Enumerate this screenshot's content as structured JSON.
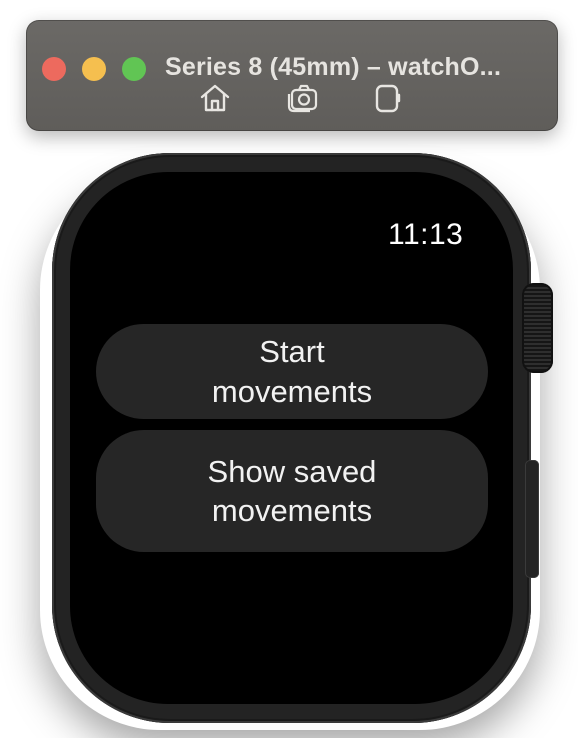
{
  "window": {
    "title": "Series 8 (45mm) – watchO...",
    "controls": [
      "close",
      "minimize",
      "zoom"
    ],
    "toolbar": [
      {
        "icon": "home-icon"
      },
      {
        "icon": "screenshot-camera-icon"
      },
      {
        "icon": "rotate-device-icon"
      }
    ]
  },
  "watch": {
    "time": "11:13",
    "buttons": [
      {
        "label": "Start movements"
      },
      {
        "label": "Show saved movements"
      }
    ]
  },
  "colors": {
    "screen": "#000000",
    "button_bg": "#262626",
    "close": "#ed6a5e",
    "minimize": "#f5bf4f",
    "zoom": "#61c554"
  }
}
